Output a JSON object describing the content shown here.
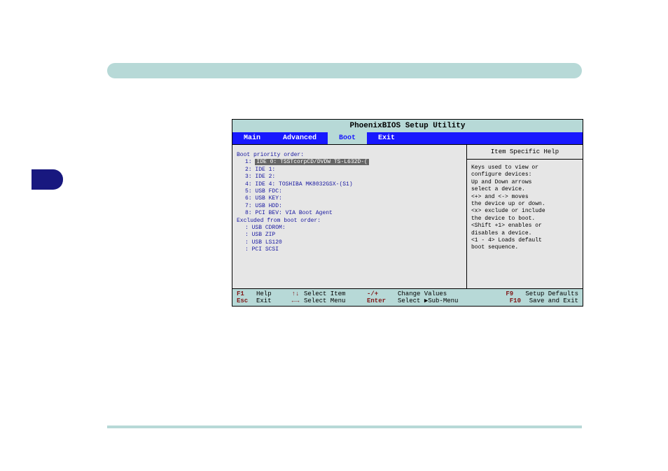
{
  "title": "PhoenixBIOS Setup Utility",
  "tabs": [
    "Main",
    "Advanced",
    "Boot",
    "Exit"
  ],
  "active_tab": "Boot",
  "left": {
    "heading1": "Boot priority order:",
    "items1": [
      {
        "num": "1:",
        "label": "IDE 0: TSSTcorpCD/DVDW TS-L632D-(",
        "selected": true
      },
      {
        "num": "2:",
        "label": "IDE 1:"
      },
      {
        "num": "3:",
        "label": "IDE 2:"
      },
      {
        "num": "4:",
        "label": "IDE 4: TOSHIBA MK8032GSX-(S1)"
      },
      {
        "num": "5:",
        "label": "USB FDC:"
      },
      {
        "num": "6:",
        "label": "USB KEY:"
      },
      {
        "num": "7:",
        "label": "USB HDD:"
      },
      {
        "num": "8:",
        "label": "PCI BEV: VIA Boot Agent"
      }
    ],
    "heading2": "Excluded from boot order:",
    "items2": [
      {
        "num": ":",
        "label": "USB CDROM:"
      },
      {
        "num": ":",
        "label": "USB ZIP"
      },
      {
        "num": ":",
        "label": "USB LS120"
      },
      {
        "num": ":",
        "label": "PCI SCSI"
      }
    ]
  },
  "help": {
    "title": "Item Specific Help",
    "body": "Keys used to view or\nconfigure devices:\nUp and Down arrows\nselect a device.\n<+> and <-> moves\nthe device up or down.\n<x> exclude or include\nthe device to boot.\n<Shift +1> enables or\ndisables a device.\n<1 - 4> Loads default\nboot sequence."
  },
  "footer": {
    "r1": {
      "k1": "F1",
      "l1": "Help",
      "a1": "↑↓",
      "d1": "Select Item",
      "k2": "-/+",
      "d2": "Change Values",
      "k3": "F9",
      "d3": "Setup Defaults"
    },
    "r2": {
      "k1": "Esc",
      "l1": "Exit",
      "a1": "←→",
      "d1": "Select Menu",
      "k2": "Enter",
      "d2l": "Select ",
      "d2r": "Sub-Menu",
      "k3": "F10",
      "d3": "Save and Exit"
    }
  }
}
